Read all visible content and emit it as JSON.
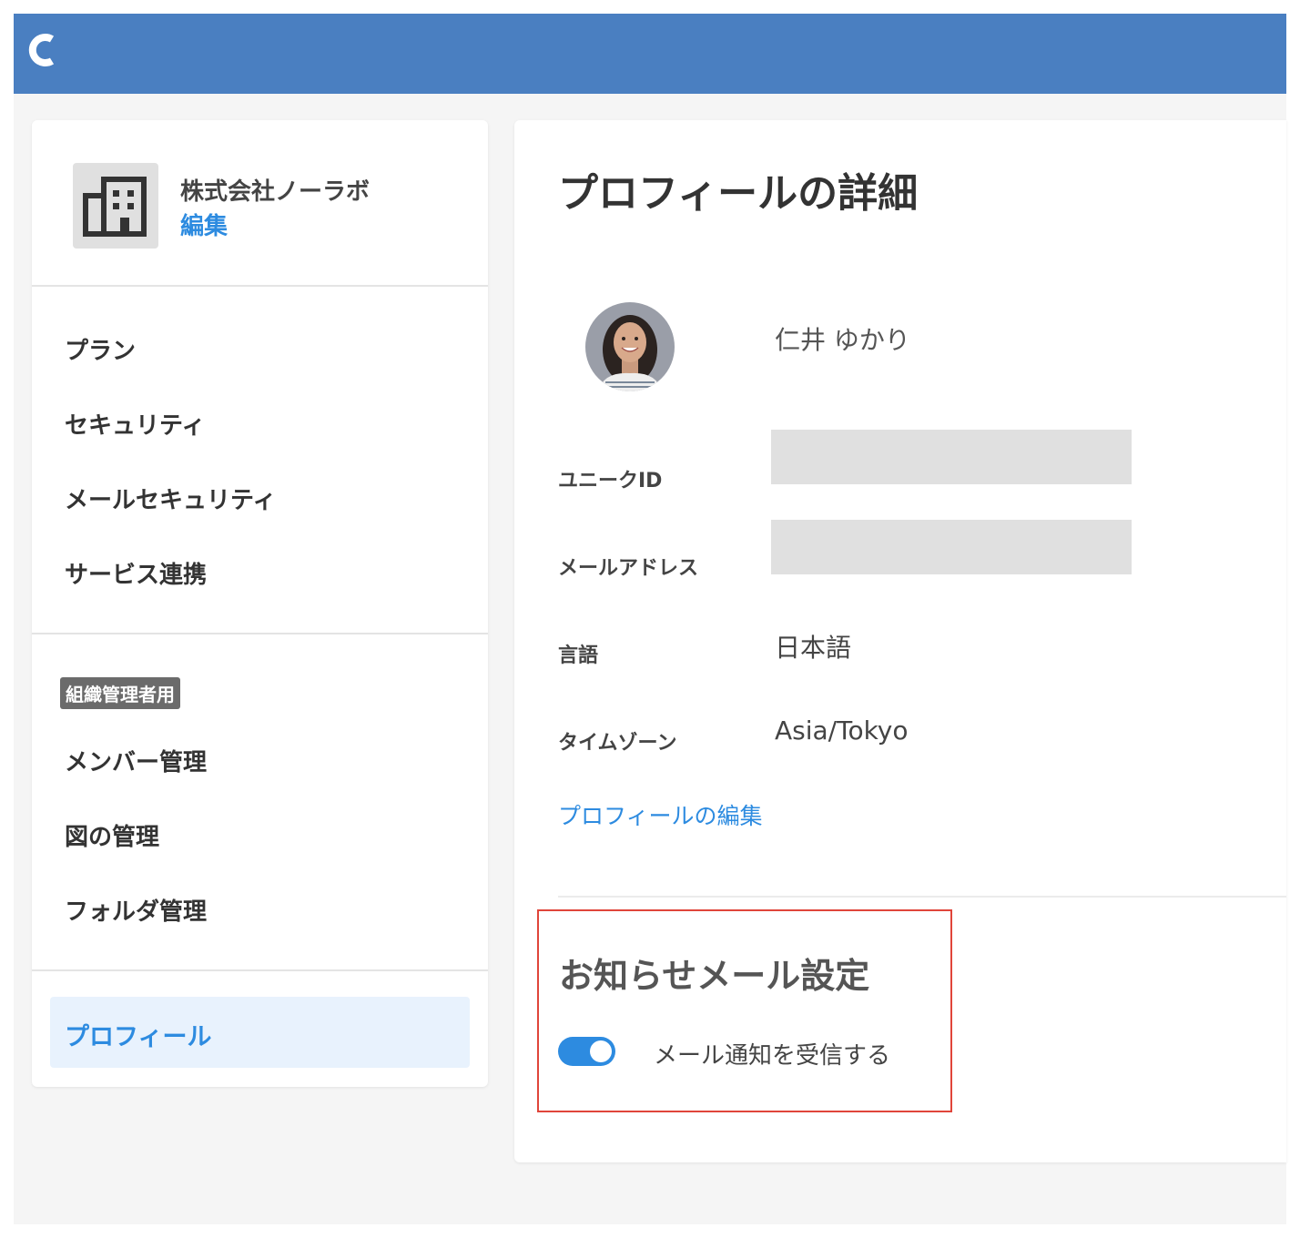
{
  "header": {
    "logo_icon": "brand-c-logo-icon"
  },
  "organization": {
    "icon": "building-icon",
    "name": "株式会社ノーラボ",
    "edit_label": "編集"
  },
  "sidebar": {
    "section1": [
      "プラン",
      "セキュリティ",
      "メールセキュリティ",
      "サービス連携"
    ],
    "admin_badge": "組織管理者用",
    "section2": [
      "メンバー管理",
      "図の管理",
      "フォルダ管理"
    ],
    "active_item": "プロフィール"
  },
  "profile": {
    "title": "プロフィールの詳細",
    "user_name": "仁井 ゆかり",
    "fields": {
      "unique_id_label": "ユニークID",
      "email_label": "メールアドレス",
      "language_label": "言語",
      "language_value": "日本語",
      "timezone_label": "タイムゾーン",
      "timezone_value": "Asia/Tokyo"
    },
    "edit_link": "プロフィールの編集"
  },
  "notifications": {
    "title": "お知らせメール設定",
    "toggle_label": "メール通知を受信する",
    "toggle_on": true
  },
  "colors": {
    "header": "#4a7fc1",
    "accent": "#2d8be0",
    "highlight_border": "#e0453a"
  }
}
